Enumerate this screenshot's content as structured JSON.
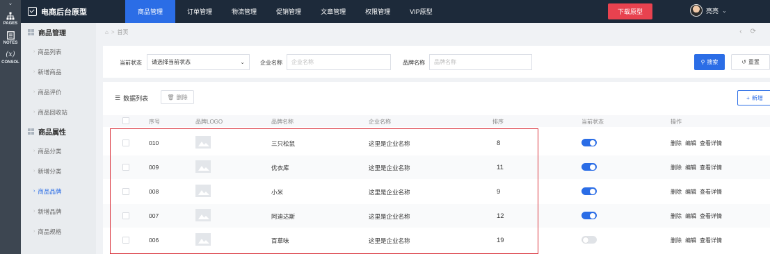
{
  "rail": {
    "items": [
      {
        "label": "PAGES",
        "icon": "sitemap-icon"
      },
      {
        "label": "NOTES",
        "icon": "notes-icon"
      },
      {
        "label": "CONSOL",
        "icon": "variable-icon"
      }
    ],
    "variable_glyph": "(x)"
  },
  "topbar": {
    "brand": "电商后台原型",
    "nav": [
      "商品管理",
      "订单管理",
      "物流管理",
      "促销管理",
      "文章管理",
      "权限管理",
      "VIP原型"
    ],
    "download": "下载原型",
    "username": "亮亮"
  },
  "sidebar": {
    "group1": "商品管理",
    "group1_items": [
      "商品列表",
      "新增商品",
      "商品评价",
      "商品回收站"
    ],
    "group2": "商品属性",
    "group2_items": [
      "商品分类",
      "新增分类",
      "商品品牌",
      "新增品牌",
      "商品规格"
    ]
  },
  "breadcrumb": {
    "home": "首页"
  },
  "filters": {
    "status_label": "当前状态",
    "status_value": "请选择当前状态",
    "company_label": "企业名称",
    "company_placeholder": "企业名称",
    "brand_label": "品牌名称",
    "brand_placeholder": "品牌名称",
    "search": "搜索",
    "reset": "重置"
  },
  "table": {
    "title": "数据列表",
    "delete": "删除",
    "add": "新增",
    "columns": [
      "序号",
      "品牌LOGO",
      "品牌名称",
      "企业名称",
      "排序",
      "当前状态",
      "操作"
    ],
    "rows": [
      {
        "id": "010",
        "brand": "三只松鼠",
        "company": "这里是企业名称",
        "sort": "8",
        "on": true
      },
      {
        "id": "009",
        "brand": "优衣库",
        "company": "这里是企业名称",
        "sort": "11",
        "on": true
      },
      {
        "id": "008",
        "brand": "小米",
        "company": "这里是企业名称",
        "sort": "9",
        "on": true
      },
      {
        "id": "007",
        "brand": "阿迪达斯",
        "company": "这里是企业名称",
        "sort": "12",
        "on": true
      },
      {
        "id": "006",
        "brand": "百草味",
        "company": "这里是企业名称",
        "sort": "19",
        "on": false
      }
    ],
    "ops": [
      "删除",
      "编辑",
      "查看详情"
    ]
  },
  "colors": {
    "accent": "#2b6de6",
    "danger": "#e8424f",
    "topbar": "#1d2a3a",
    "highlight": "#d9303a"
  }
}
